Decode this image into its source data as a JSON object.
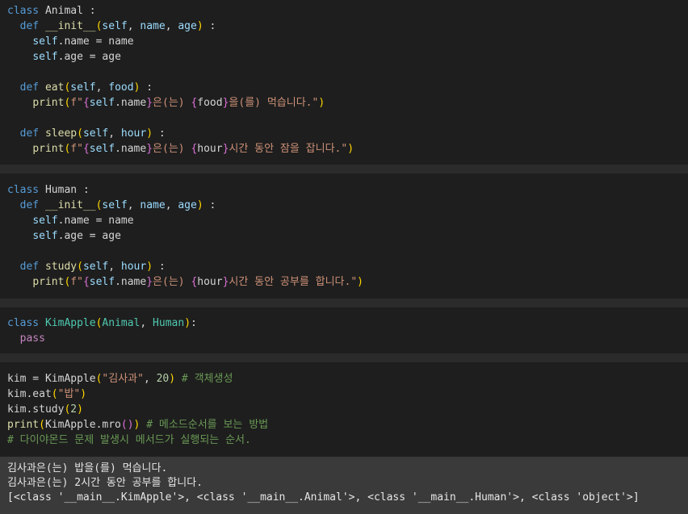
{
  "cells": [
    {
      "lines": [
        [
          {
            "t": "class",
            "c": "kw"
          },
          {
            "t": " Animal :"
          }
        ],
        [
          {
            "t": "  "
          },
          {
            "t": "def",
            "c": "kw"
          },
          {
            "t": " "
          },
          {
            "t": "__init__",
            "c": "fn"
          },
          {
            "t": "(",
            "c": "br1"
          },
          {
            "t": "self",
            "c": "slf"
          },
          {
            "t": ", "
          },
          {
            "t": "name",
            "c": "pr"
          },
          {
            "t": ", "
          },
          {
            "t": "age",
            "c": "pr"
          },
          {
            "t": ")",
            "c": "br1"
          },
          {
            "t": " :"
          }
        ],
        [
          {
            "t": "    "
          },
          {
            "t": "self",
            "c": "slf"
          },
          {
            "t": ".name = name"
          }
        ],
        [
          {
            "t": "    "
          },
          {
            "t": "self",
            "c": "slf"
          },
          {
            "t": ".age = age"
          }
        ],
        [
          {
            "t": ""
          }
        ],
        [
          {
            "t": "  "
          },
          {
            "t": "def",
            "c": "kw"
          },
          {
            "t": " "
          },
          {
            "t": "eat",
            "c": "fn"
          },
          {
            "t": "(",
            "c": "br1"
          },
          {
            "t": "self",
            "c": "slf"
          },
          {
            "t": ", "
          },
          {
            "t": "food",
            "c": "pr"
          },
          {
            "t": ")",
            "c": "br1"
          },
          {
            "t": " :"
          }
        ],
        [
          {
            "t": "    "
          },
          {
            "t": "print",
            "c": "fn"
          },
          {
            "t": "(",
            "c": "br1"
          },
          {
            "t": "f\"",
            "c": "str"
          },
          {
            "t": "{",
            "c": "br2"
          },
          {
            "t": "self",
            "c": "slf"
          },
          {
            "t": ".name"
          },
          {
            "t": "}",
            "c": "br2"
          },
          {
            "t": "은(는) ",
            "c": "str"
          },
          {
            "t": "{",
            "c": "br2"
          },
          {
            "t": "food"
          },
          {
            "t": "}",
            "c": "br2"
          },
          {
            "t": "을(를) 먹습니다.\"",
            "c": "str"
          },
          {
            "t": ")",
            "c": "br1"
          }
        ],
        [
          {
            "t": ""
          }
        ],
        [
          {
            "t": "  "
          },
          {
            "t": "def",
            "c": "kw"
          },
          {
            "t": " "
          },
          {
            "t": "sleep",
            "c": "fn"
          },
          {
            "t": "(",
            "c": "br1"
          },
          {
            "t": "self",
            "c": "slf"
          },
          {
            "t": ", "
          },
          {
            "t": "hour",
            "c": "pr"
          },
          {
            "t": ")",
            "c": "br1"
          },
          {
            "t": " :"
          }
        ],
        [
          {
            "t": "    "
          },
          {
            "t": "print",
            "c": "fn"
          },
          {
            "t": "(",
            "c": "br1"
          },
          {
            "t": "f\"",
            "c": "str"
          },
          {
            "t": "{",
            "c": "br2"
          },
          {
            "t": "self",
            "c": "slf"
          },
          {
            "t": ".name"
          },
          {
            "t": "}",
            "c": "br2"
          },
          {
            "t": "은(는) ",
            "c": "str"
          },
          {
            "t": "{",
            "c": "br2"
          },
          {
            "t": "hour"
          },
          {
            "t": "}",
            "c": "br2"
          },
          {
            "t": "시간 동안 잠을 잡니다.\"",
            "c": "str"
          },
          {
            "t": ")",
            "c": "br1"
          }
        ]
      ]
    },
    {
      "lines": [
        [
          {
            "t": "class",
            "c": "kw"
          },
          {
            "t": " Human :"
          }
        ],
        [
          {
            "t": "  "
          },
          {
            "t": "def",
            "c": "kw"
          },
          {
            "t": " "
          },
          {
            "t": "__init__",
            "c": "fn"
          },
          {
            "t": "(",
            "c": "br1"
          },
          {
            "t": "self",
            "c": "slf"
          },
          {
            "t": ", "
          },
          {
            "t": "name",
            "c": "pr"
          },
          {
            "t": ", "
          },
          {
            "t": "age",
            "c": "pr"
          },
          {
            "t": ")",
            "c": "br1"
          },
          {
            "t": " :"
          }
        ],
        [
          {
            "t": "    "
          },
          {
            "t": "self",
            "c": "slf"
          },
          {
            "t": ".name = name"
          }
        ],
        [
          {
            "t": "    "
          },
          {
            "t": "self",
            "c": "slf"
          },
          {
            "t": ".age = age"
          }
        ],
        [
          {
            "t": ""
          }
        ],
        [
          {
            "t": "  "
          },
          {
            "t": "def",
            "c": "kw"
          },
          {
            "t": " "
          },
          {
            "t": "study",
            "c": "fn"
          },
          {
            "t": "(",
            "c": "br1"
          },
          {
            "t": "self",
            "c": "slf"
          },
          {
            "t": ", "
          },
          {
            "t": "hour",
            "c": "pr"
          },
          {
            "t": ")",
            "c": "br1"
          },
          {
            "t": " :"
          }
        ],
        [
          {
            "t": "    "
          },
          {
            "t": "print",
            "c": "fn"
          },
          {
            "t": "(",
            "c": "br1"
          },
          {
            "t": "f\"",
            "c": "str"
          },
          {
            "t": "{",
            "c": "br2"
          },
          {
            "t": "self",
            "c": "slf"
          },
          {
            "t": ".name"
          },
          {
            "t": "}",
            "c": "br2"
          },
          {
            "t": "은(는) ",
            "c": "str"
          },
          {
            "t": "{",
            "c": "br2"
          },
          {
            "t": "hour"
          },
          {
            "t": "}",
            "c": "br2"
          },
          {
            "t": "시간 동안 공부를 합니다.\"",
            "c": "str"
          },
          {
            "t": ")",
            "c": "br1"
          }
        ]
      ]
    },
    {
      "lines": [
        [
          {
            "t": "class",
            "c": "kw"
          },
          {
            "t": " "
          },
          {
            "t": "KimApple",
            "c": "cls"
          },
          {
            "t": "(",
            "c": "br1"
          },
          {
            "t": "Animal",
            "c": "cls"
          },
          {
            "t": ", "
          },
          {
            "t": "Human",
            "c": "cls"
          },
          {
            "t": ")",
            "c": "br1"
          },
          {
            "t": ":"
          }
        ],
        [
          {
            "t": "  "
          },
          {
            "t": "pass",
            "c": "pass"
          }
        ]
      ]
    },
    {
      "lines": [
        [
          {
            "t": "kim = KimApple"
          },
          {
            "t": "(",
            "c": "br1"
          },
          {
            "t": "\"김사과\"",
            "c": "str"
          },
          {
            "t": ", "
          },
          {
            "t": "20",
            "c": "num"
          },
          {
            "t": ")",
            "c": "br1"
          },
          {
            "t": " "
          },
          {
            "t": "# 객체생성",
            "c": "cmt"
          }
        ],
        [
          {
            "t": "kim.eat"
          },
          {
            "t": "(",
            "c": "br1"
          },
          {
            "t": "\"밥\"",
            "c": "str"
          },
          {
            "t": ")",
            "c": "br1"
          }
        ],
        [
          {
            "t": "kim.study"
          },
          {
            "t": "(",
            "c": "br1"
          },
          {
            "t": "2",
            "c": "num"
          },
          {
            "t": ")",
            "c": "br1"
          }
        ],
        [
          {
            "t": "print",
            "c": "fn"
          },
          {
            "t": "(",
            "c": "br1"
          },
          {
            "t": "KimApple.mro"
          },
          {
            "t": "(",
            "c": "br2"
          },
          {
            "t": ")",
            "c": "br2"
          },
          {
            "t": ")",
            "c": "br1"
          },
          {
            "t": " "
          },
          {
            "t": "# 메소드순서를 보는 방법",
            "c": "cmt"
          }
        ],
        [
          {
            "t": "# 다이야몬드 문제 발생시 메서드가 실행되는 순서.",
            "c": "cmt"
          }
        ]
      ]
    }
  ],
  "output": [
    "김사과은(는) 밥을(를) 먹습니다.",
    "김사과은(는) 2시간 동안 공부를 합니다.",
    "[<class '__main__.KimApple'>, <class '__main__.Animal'>, <class '__main__.Human'>, <class 'object'>]"
  ]
}
